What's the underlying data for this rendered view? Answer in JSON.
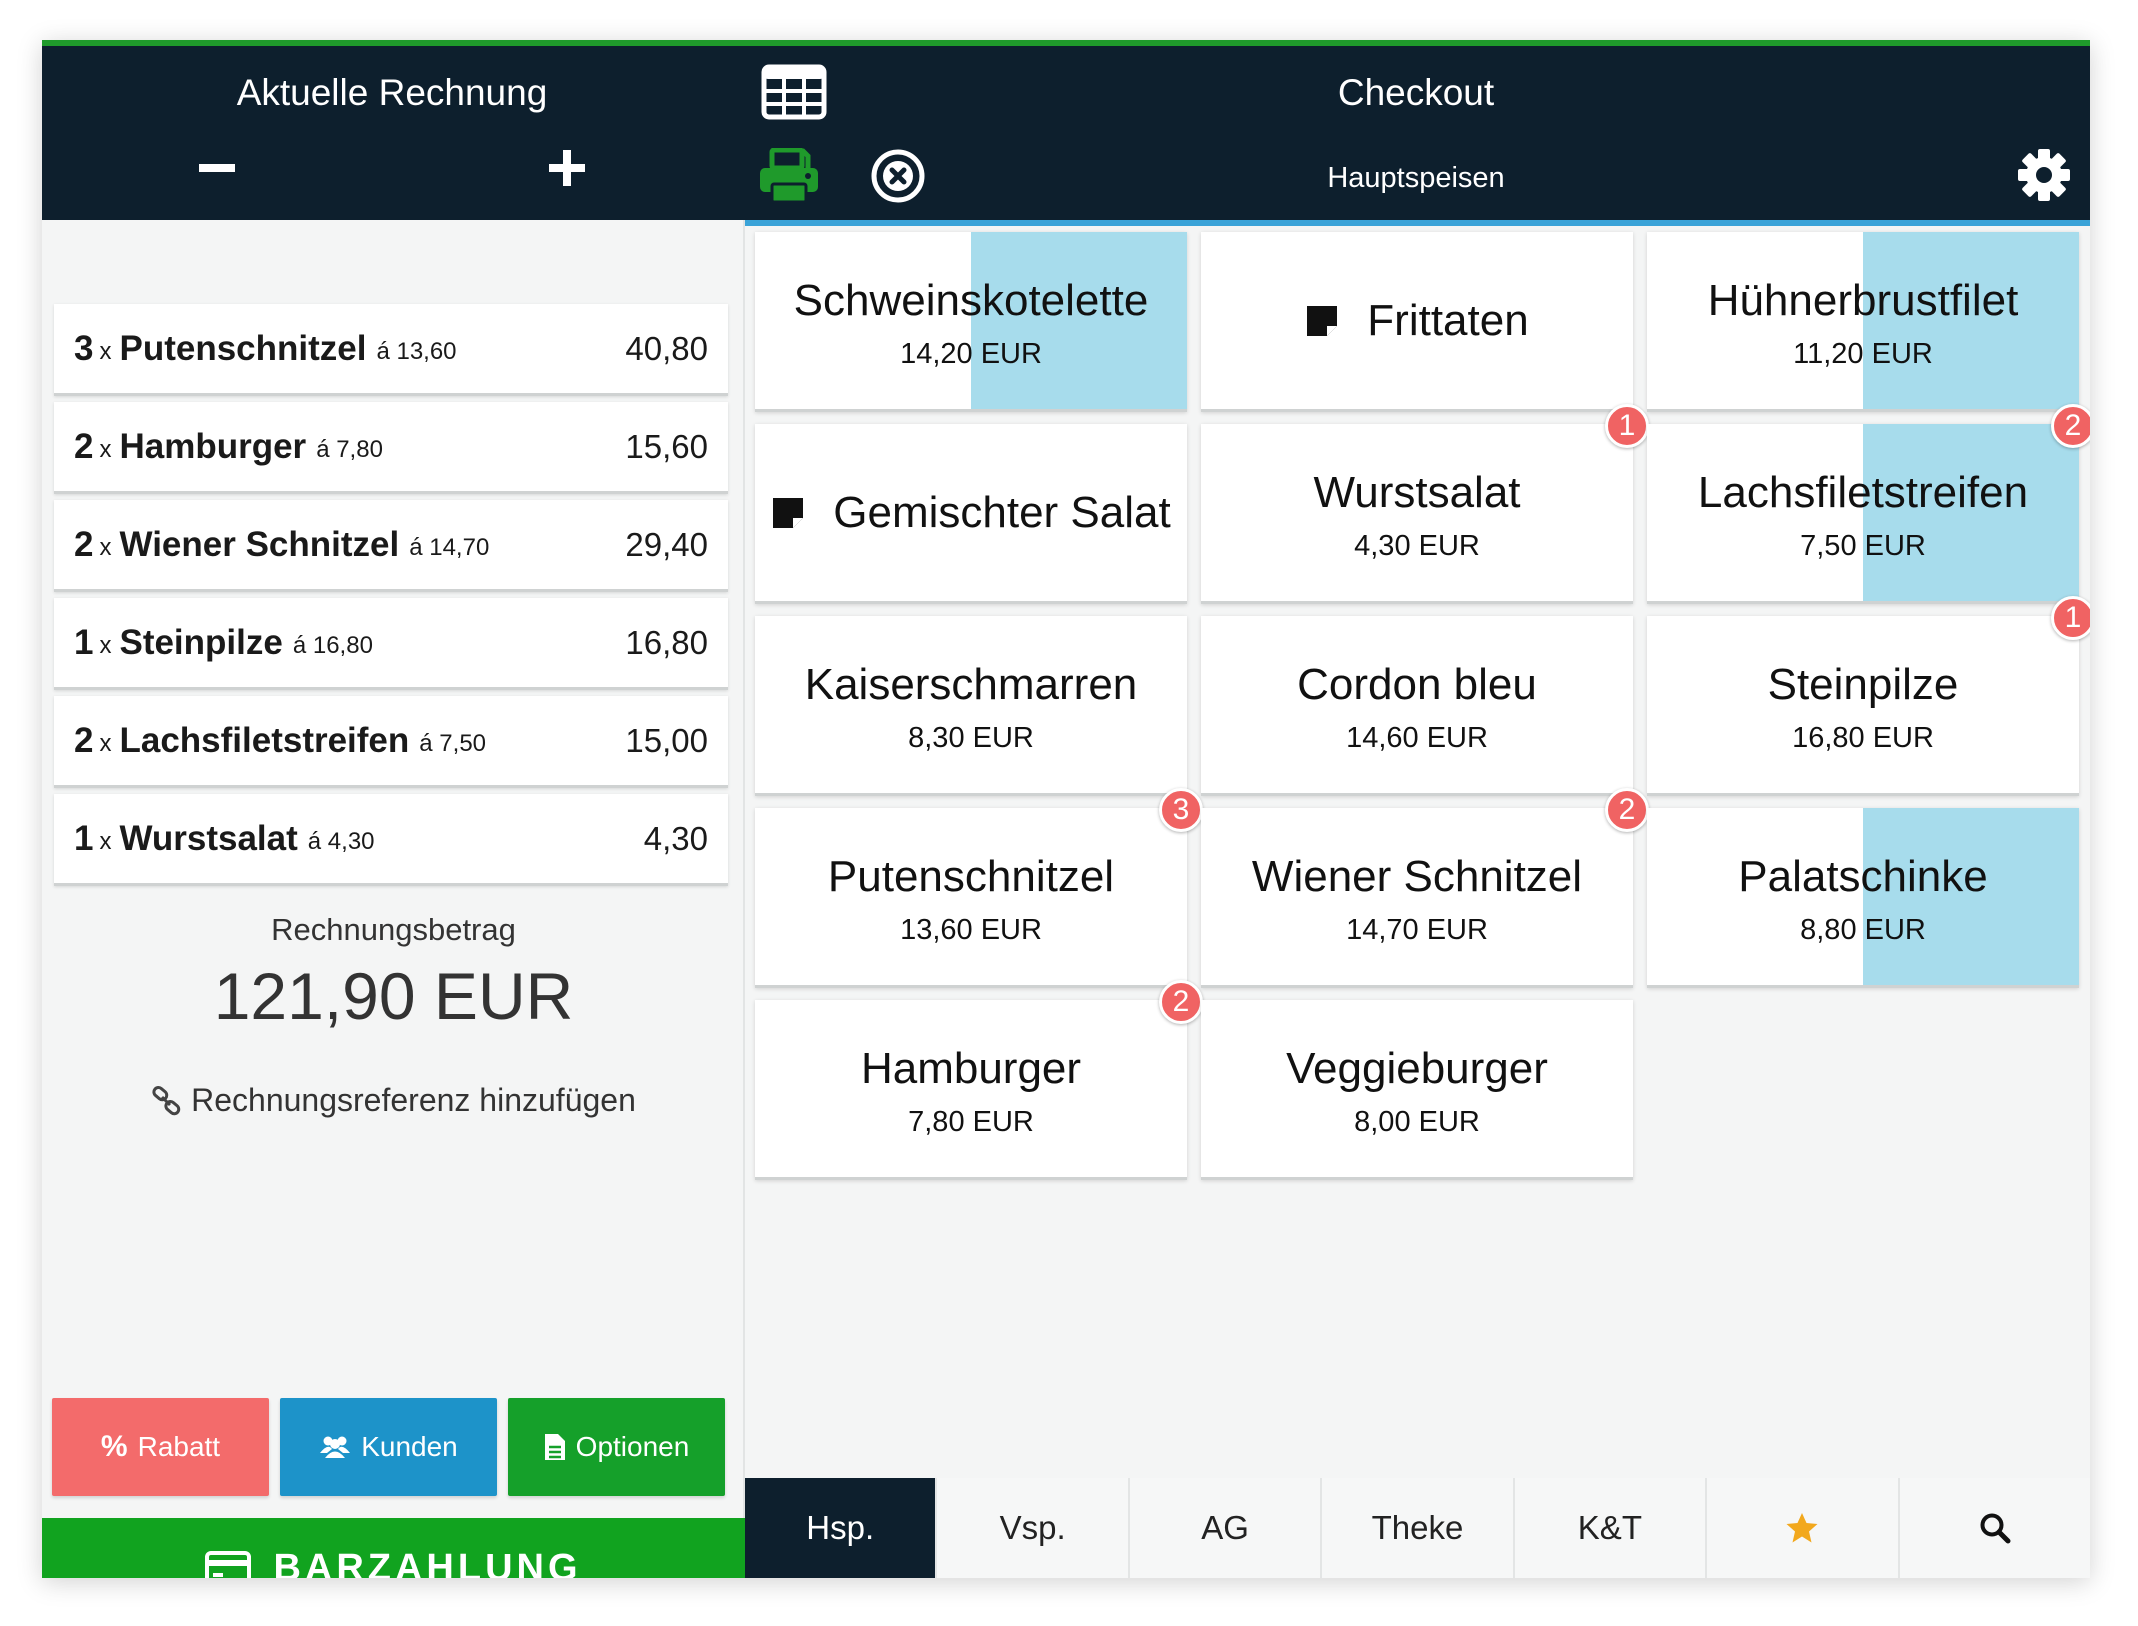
{
  "header": {
    "left_title": "Aktuelle Rechnung",
    "right_title": "Checkout",
    "category": "Hauptspeisen"
  },
  "colors": {
    "header_bg": "#0d1f2d",
    "green": "#1f9a2b",
    "red": "#f36b6b",
    "blue": "#3aa3d8",
    "highlight": "#a7dcec",
    "badge": "#f06363"
  },
  "icons": {
    "minus": "minus-icon",
    "plus": "plus-icon",
    "grid": "grid-icon",
    "print": "printer-icon",
    "close": "close-circle-icon",
    "settings": "gear-icon",
    "note": "note-icon",
    "link": "link-icon",
    "card": "credit-card-icon"
  },
  "bill": {
    "items": [
      {
        "qty": "3",
        "x": "x",
        "name": "Putenschnitzel",
        "unit": "á 13,60",
        "total": "40,80"
      },
      {
        "qty": "2",
        "x": "x",
        "name": "Hamburger",
        "unit": "á 7,80",
        "total": "15,60"
      },
      {
        "qty": "2",
        "x": "x",
        "name": "Wiener Schnitzel",
        "unit": "á 14,70",
        "total": "29,40"
      },
      {
        "qty": "1",
        "x": "x",
        "name": "Steinpilze",
        "unit": "á 16,80",
        "total": "16,80"
      },
      {
        "qty": "2",
        "x": "x",
        "name": "Lachsfiletstreifen",
        "unit": "á 7,50",
        "total": "15,00"
      },
      {
        "qty": "1",
        "x": "x",
        "name": "Wurstsalat",
        "unit": "á 4,30",
        "total": "4,30"
      }
    ],
    "sum_label": "Rechnungsbetrag",
    "sum_value": "121,90 EUR",
    "reference_link": "Rechnungsreferenz hinzufügen"
  },
  "actions": {
    "rabatt": "Rabatt",
    "kunden": "Kunden",
    "optionen": "Optionen",
    "pay": "BARZAHLUNG"
  },
  "products": [
    {
      "name": "Schweinskotelette",
      "price": "14,20 EUR",
      "highlight": true,
      "badge": ""
    },
    {
      "name": "Frittaten",
      "price": "",
      "highlight": false,
      "badge": "",
      "note": true
    },
    {
      "name": "Hühnerbrustfilet",
      "price": "11,20 EUR",
      "highlight": true,
      "badge": ""
    },
    {
      "name": "Gemischter Salat",
      "price": "",
      "highlight": false,
      "badge": "",
      "note": true
    },
    {
      "name": "Wurstsalat",
      "price": "4,30 EUR",
      "highlight": false,
      "badge": "1"
    },
    {
      "name": "Lachsfiletstreifen",
      "price": "7,50 EUR",
      "highlight": true,
      "badge": "2"
    },
    {
      "name": "Kaiserschmarren",
      "price": "8,30 EUR",
      "highlight": false,
      "badge": ""
    },
    {
      "name": "Cordon bleu",
      "price": "14,60 EUR",
      "highlight": false,
      "badge": ""
    },
    {
      "name": "Steinpilze",
      "price": "16,80 EUR",
      "highlight": false,
      "badge": "1"
    },
    {
      "name": "Putenschnitzel",
      "price": "13,60 EUR",
      "highlight": false,
      "badge": "3"
    },
    {
      "name": "Wiener Schnitzel",
      "price": "14,70 EUR",
      "highlight": false,
      "badge": "2"
    },
    {
      "name": "Palatschinke",
      "price": "8,80 EUR",
      "highlight": true,
      "badge": ""
    },
    {
      "name": "Hamburger",
      "price": "7,80 EUR",
      "highlight": false,
      "badge": "2"
    },
    {
      "name": "Veggieburger",
      "price": "8,00 EUR",
      "highlight": false,
      "badge": ""
    }
  ],
  "tabs": [
    {
      "label": "Hsp.",
      "active": true
    },
    {
      "label": "Vsp.",
      "active": false
    },
    {
      "label": "AG",
      "active": false
    },
    {
      "label": "Theke",
      "active": false
    },
    {
      "label": "K&T",
      "active": false
    },
    {
      "label": "",
      "icon": "star-icon",
      "active": false
    },
    {
      "label": "",
      "icon": "search-icon",
      "active": false
    }
  ]
}
